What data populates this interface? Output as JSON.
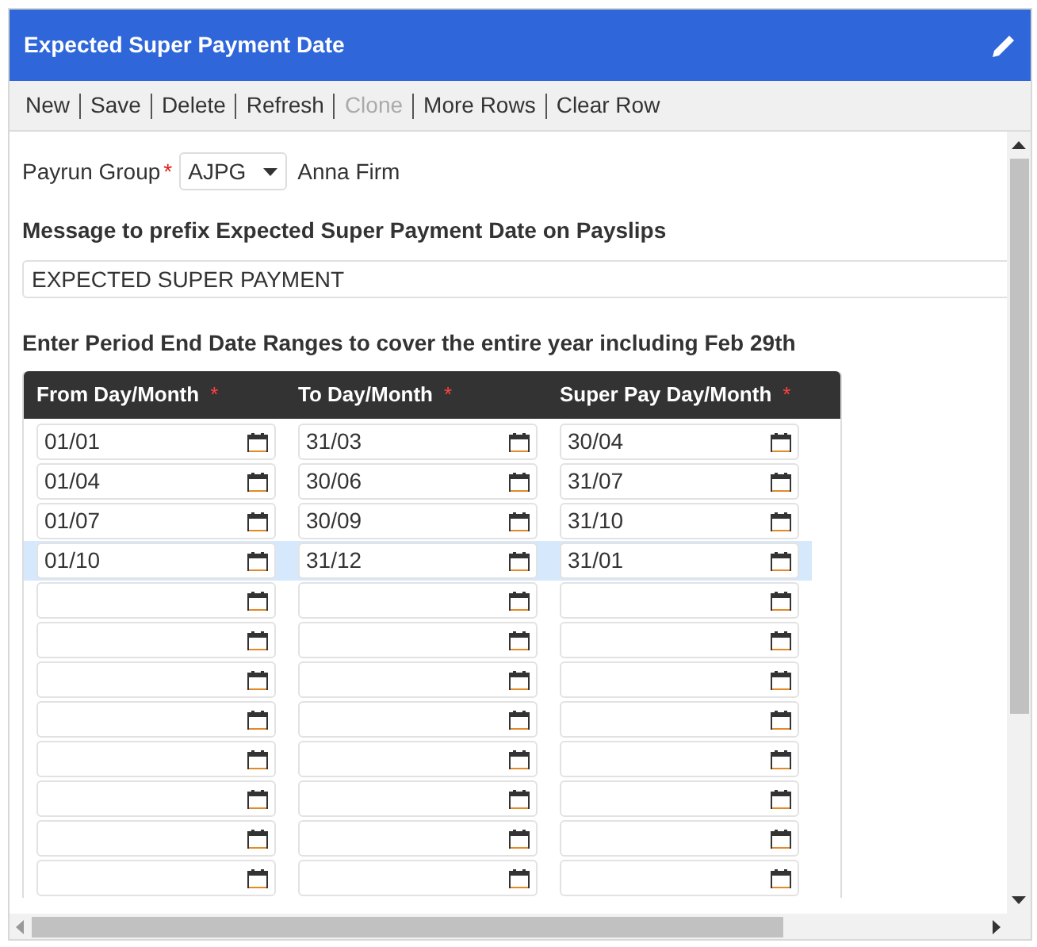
{
  "window": {
    "title": "Expected Super Payment Date"
  },
  "toolbar": [
    {
      "label": "New",
      "disabled": false
    },
    {
      "label": "Save",
      "disabled": false
    },
    {
      "label": "Delete",
      "disabled": false
    },
    {
      "label": "Refresh",
      "disabled": false
    },
    {
      "label": "Clone",
      "disabled": true
    },
    {
      "label": "More Rows",
      "disabled": false
    },
    {
      "label": "Clear Row",
      "disabled": false
    }
  ],
  "payrun_group": {
    "label": "Payrun Group",
    "required_mark": "*",
    "value": "AJPG",
    "description": "Anna Firm"
  },
  "message": {
    "label": "Message to prefix Expected Super Payment Date on Payslips",
    "value": "EXPECTED SUPER PAYMENT"
  },
  "table_heading": "Enter Period End Date Ranges to cover the entire year including Feb 29th",
  "table": {
    "columns": [
      {
        "label": "From Day/Month",
        "required_mark": "*"
      },
      {
        "label": "To Day/Month",
        "required_mark": "*"
      },
      {
        "label": "Super Pay Day/Month",
        "required_mark": "*"
      }
    ],
    "rows": [
      {
        "values": [
          "01/01",
          "31/03",
          "30/04"
        ],
        "selected": false
      },
      {
        "values": [
          "01/04",
          "30/06",
          "31/07"
        ],
        "selected": false
      },
      {
        "values": [
          "01/07",
          "30/09",
          "31/10"
        ],
        "selected": false
      },
      {
        "values": [
          "01/10",
          "31/12",
          "31/01"
        ],
        "selected": true
      },
      {
        "selected": false
      },
      {
        "selected": false
      },
      {
        "selected": false
      },
      {
        "selected": false
      },
      {
        "selected": false
      },
      {
        "selected": false
      },
      {
        "selected": false
      },
      {
        "selected": false
      }
    ]
  }
}
